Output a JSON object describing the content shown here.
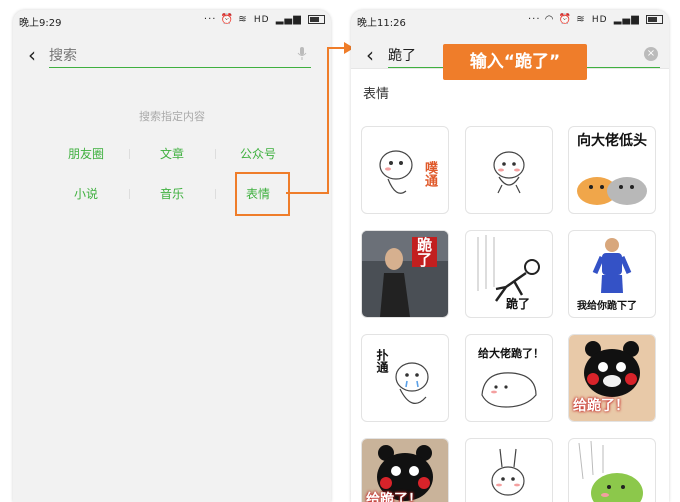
{
  "left_screen": {
    "status_time": "晚上9:29",
    "status_network": "HD",
    "search_placeholder": "搜索",
    "hint": "搜索指定内容",
    "categories": [
      {
        "label": "朋友圈"
      },
      {
        "label": "文章"
      },
      {
        "label": "公众号"
      },
      {
        "label": "小说"
      },
      {
        "label": "音乐"
      },
      {
        "label": "表情"
      }
    ],
    "highlighted_category": "表情"
  },
  "right_screen": {
    "status_time": "晚上11:26",
    "status_network": "HD",
    "query": "跪了",
    "callout": "输入“跪了”",
    "section_title": "表情",
    "stickers": [
      {
        "caption": "噗通"
      },
      {
        "caption": ""
      },
      {
        "caption": "向大佬低头"
      },
      {
        "caption": "跪了"
      },
      {
        "caption": "跪了"
      },
      {
        "caption": "我给你跪下了"
      },
      {
        "caption": "扑通"
      },
      {
        "caption": "给大佬跪了！"
      },
      {
        "caption": "给跪了！"
      },
      {
        "caption": "给跪了！"
      },
      {
        "caption": ""
      },
      {
        "caption": ""
      }
    ]
  },
  "colors": {
    "accent_green": "#3fb03f",
    "highlight_orange": "#ef7d2a",
    "background": "#f2f2f2"
  }
}
